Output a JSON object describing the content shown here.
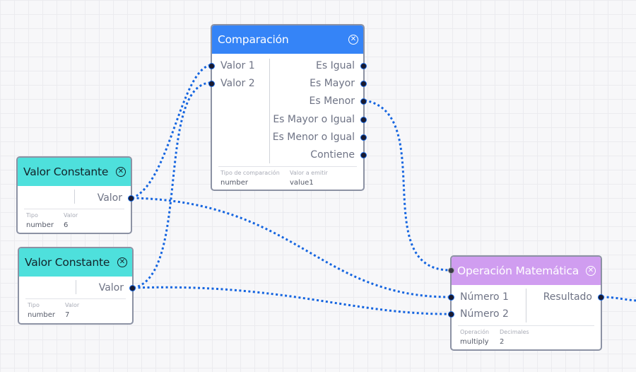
{
  "nodes": {
    "comparacion": {
      "title": "Comparación",
      "header_color": "#3584f7",
      "inputs": [
        "Valor 1",
        "Valor 2"
      ],
      "outputs": [
        "Es Igual",
        "Es Mayor",
        "Es Menor",
        "Es Mayor o Igual",
        "Es Menor o Igual",
        "Contiene"
      ],
      "props": [
        {
          "key": "Tipo de comparación",
          "value": "number"
        },
        {
          "key": "Valor a emitir",
          "value": "value1"
        }
      ]
    },
    "const1": {
      "title": "Valor Constante",
      "header_color": "#4ee0dc",
      "output": "Valor",
      "props": [
        {
          "key": "Tipo",
          "value": "number"
        },
        {
          "key": "Valor",
          "value": "6"
        }
      ]
    },
    "const2": {
      "title": "Valor Constante",
      "header_color": "#4ee0dc",
      "output": "Valor",
      "props": [
        {
          "key": "Tipo",
          "value": "number"
        },
        {
          "key": "Valor",
          "value": "7"
        }
      ]
    },
    "matematica": {
      "title": "Operación Matemática",
      "header_color": "#d09df0",
      "inputs": [
        "Número 1",
        "Número 2"
      ],
      "outputs": [
        "Resultado"
      ],
      "props": [
        {
          "key": "Operación",
          "value": "multiply"
        },
        {
          "key": "Decimales",
          "value": "2"
        }
      ]
    }
  },
  "close_icon": "close-circle-icon",
  "wire_color": "#1565e0"
}
